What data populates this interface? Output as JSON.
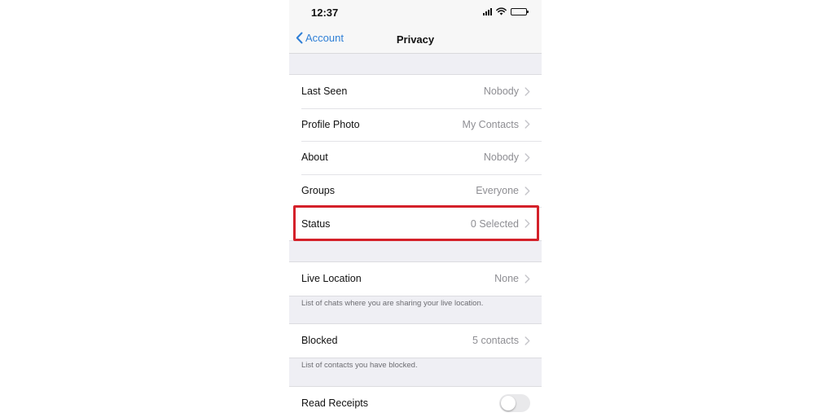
{
  "status_bar": {
    "time": "12:37"
  },
  "nav": {
    "back_label": "Account",
    "title": "Privacy"
  },
  "privacy_rows": [
    {
      "label": "Last Seen",
      "value": "Nobody"
    },
    {
      "label": "Profile Photo",
      "value": "My Contacts"
    },
    {
      "label": "About",
      "value": "Nobody"
    },
    {
      "label": "Groups",
      "value": "Everyone"
    },
    {
      "label": "Status",
      "value": "0 Selected"
    }
  ],
  "live_location": {
    "label": "Live Location",
    "value": "None",
    "footnote": "List of chats where you are sharing your live location."
  },
  "blocked": {
    "label": "Blocked",
    "value": "5 contacts",
    "footnote": "List of contacts you have blocked."
  },
  "read_receipts": {
    "label": "Read Receipts",
    "enabled": false
  },
  "colors": {
    "accent": "#2f7fd6",
    "highlight": "#d4212a",
    "background": "#efeff4"
  }
}
